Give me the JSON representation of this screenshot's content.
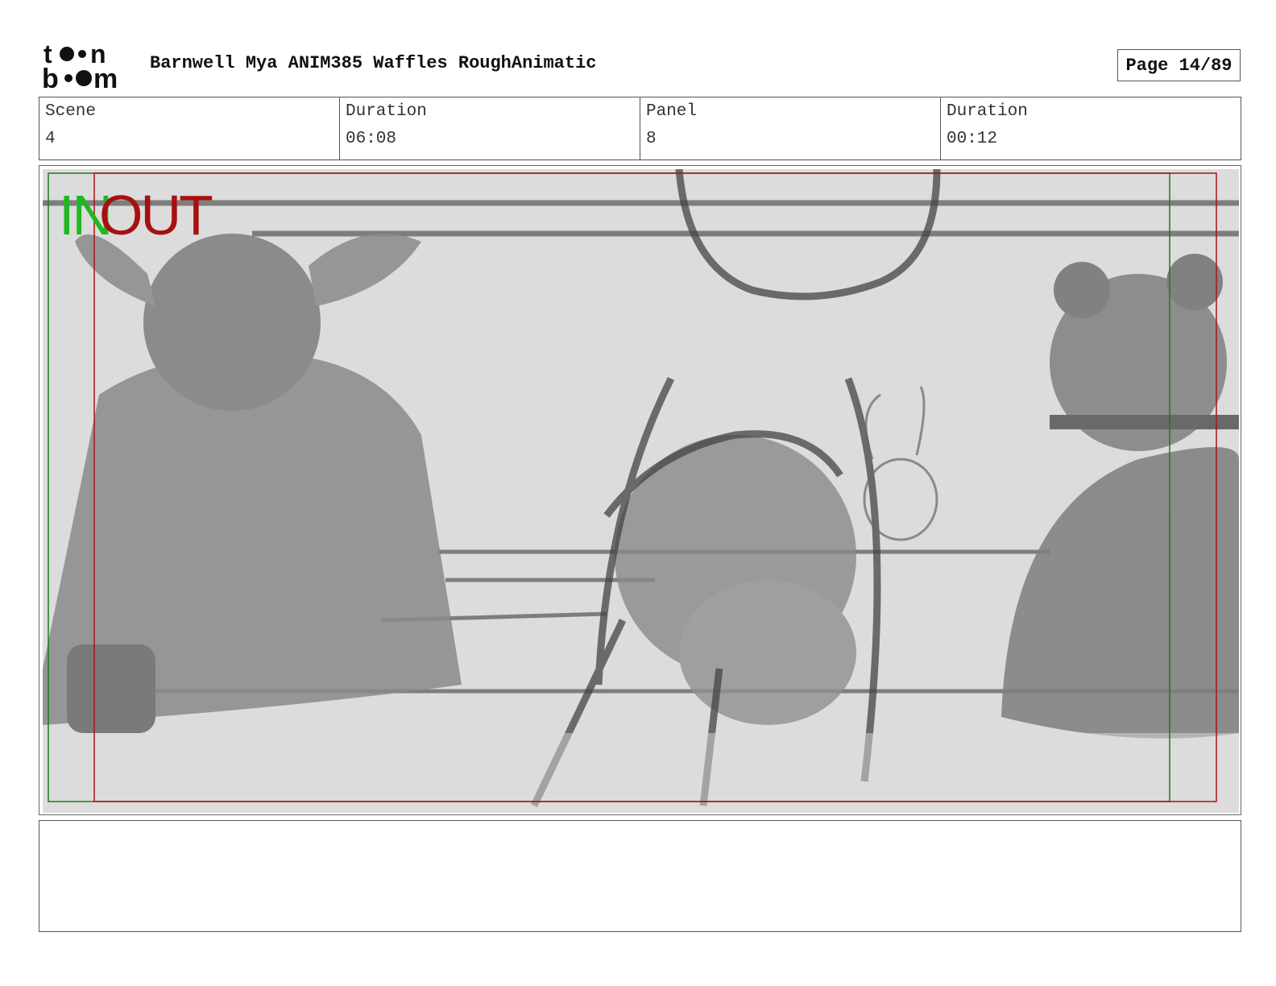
{
  "header": {
    "logo_text": "toon boom",
    "title": "Barnwell Mya ANIM385 Waffles RoughAnimatic",
    "page": "Page 14/89"
  },
  "info": [
    {
      "label": "Scene",
      "value": "4"
    },
    {
      "label": "Duration",
      "value": "06:08"
    },
    {
      "label": "Panel",
      "value": "8"
    },
    {
      "label": "Duration",
      "value": "00:12"
    }
  ],
  "panel": {
    "in_label": "IN",
    "out_label": "OUT",
    "colors": {
      "in": "#1fb81f",
      "out": "#a81010",
      "sketch_bg": "#dcdcdc",
      "sketch_ink": "#555555"
    }
  },
  "notes": {
    "text": ""
  }
}
